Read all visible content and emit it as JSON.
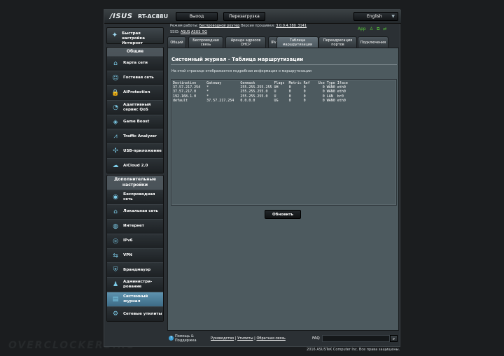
{
  "header": {
    "brand": "/ISUS",
    "model": "RT-AC88U",
    "logout_label": "Выход",
    "reboot_label": "Перезагрузка",
    "language": "English"
  },
  "info": {
    "mode_label": "Режим работы:",
    "mode_value": "Беспроводной роутер",
    "firmware_label": "Версия прошивки:",
    "firmware_value": "3.0.0.4.380_3141",
    "ssid_label": "SSID:",
    "ssid_2g": "ASUS",
    "ssid_5g": "ASUS_5G",
    "app_label": "App"
  },
  "sidebar": {
    "quick_setup": "Быстрая настройка Интернет",
    "general_header": "Общие",
    "general": [
      {
        "label": "Карта сети",
        "icon": "network-map-icon",
        "glyph": "⌂"
      },
      {
        "label": "Гостевая сеть",
        "icon": "guest-network-icon",
        "glyph": "☺"
      },
      {
        "label": "AiProtection",
        "icon": "lock-icon",
        "glyph": "🔒"
      },
      {
        "label": "Адаптивный сервис QoS",
        "icon": "qos-gauge-icon",
        "glyph": "◔"
      },
      {
        "label": "Game Boost",
        "icon": "gamepad-icon",
        "glyph": "◈"
      },
      {
        "label": "Traffic Analyzer",
        "icon": "traffic-chart-icon",
        "glyph": "⩘"
      },
      {
        "label": "USB-приложение",
        "icon": "usb-icon",
        "glyph": "✣"
      },
      {
        "label": "AiCloud 2.0",
        "icon": "cloud-icon",
        "glyph": "☁"
      }
    ],
    "advanced_header": "Дополнительные настройки",
    "advanced": [
      {
        "label": "Беспроводная сеть",
        "icon": "wifi-icon",
        "glyph": "◉"
      },
      {
        "label": "Локальная сеть",
        "icon": "home-icon",
        "glyph": "⌂"
      },
      {
        "label": "Интернет",
        "icon": "globe-icon",
        "glyph": "◍"
      },
      {
        "label": "IPv6",
        "icon": "ipv6-icon",
        "glyph": "◎"
      },
      {
        "label": "VPN",
        "icon": "vpn-icon",
        "glyph": "⇆"
      },
      {
        "label": "Брандмауэр",
        "icon": "firewall-shield-icon",
        "glyph": "⛨"
      },
      {
        "label": "Администри-рование",
        "icon": "admin-user-icon",
        "glyph": "♟"
      },
      {
        "label": "Системный журнал",
        "icon": "system-log-icon",
        "glyph": "▤",
        "active": true
      },
      {
        "label": "Сетевые утилиты",
        "icon": "network-tools-icon",
        "glyph": "⚙"
      }
    ]
  },
  "tabs": [
    {
      "label": "Общий"
    },
    {
      "label": "Беспроводная связь"
    },
    {
      "label": "Аренда адресов DHCP"
    },
    {
      "label": "IPv6"
    },
    {
      "label": "Таблица маршрутизации",
      "active": true
    },
    {
      "label": "Переадресация портов"
    },
    {
      "label": "Подключения"
    }
  ],
  "main": {
    "title": "Системный журнал - Таблица маршрутизации",
    "description": "На этой странице отображается подробная информация о маршрутизации",
    "routing_table": "Destination     Gateway         Genmask         Flags  Metric Ref    Use Type Iface\n37.57.217.254   *               255.255.255.255 UH     0      0        0 WAN0 eth0\n37.57.217.0     *               255.255.255.0   U      0      0        0 WAN0 eth0\n192.168.1.0     *               255.255.255.0   U      0      0        0 LAN  br0\ndefault         37.57.217.254   0.0.0.0         UG     0      0        0 WAN0 eth0",
    "refresh_label": "Обновить"
  },
  "footer": {
    "help_label": "Помощь & Поддержка",
    "manual": "Руководство",
    "utilities": "Утилиты",
    "feedback": "Обратная связь",
    "separator": "|",
    "faq_label": "FAQ",
    "copyright": "2016 ASUSTeK Computer Inc. Все права защищены."
  },
  "watermark": "OVERCLOCKERS.RU",
  "colors": {
    "panel": "#4d5a5f",
    "active_nav": "#5e92ae",
    "status_green": "#58c93a"
  }
}
